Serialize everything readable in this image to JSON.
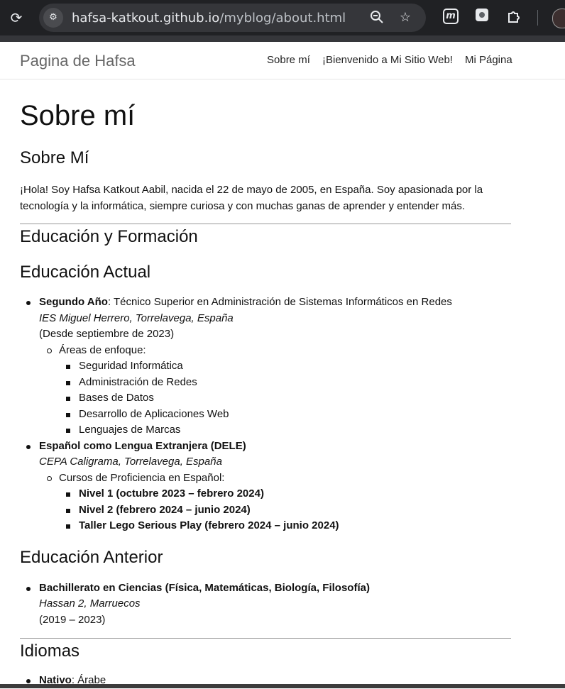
{
  "browser": {
    "url_host": "hafsa-katkout.github.io",
    "url_path": "/myblog/about.html"
  },
  "nav": {
    "brand": "Pagina de Hafsa",
    "links": [
      "Sobre mí",
      "¡Bienvenido a Mi Sitio Web!",
      "Mi Página"
    ]
  },
  "page": {
    "title": "Sobre mí",
    "about_heading": "Sobre Mí",
    "intro": "¡Hola! Soy Hafsa Katkout Aabil, nacida el 22 de mayo de 2005, en España. Soy apasionada por la tecnología y la informática, siempre curiosa y con muchas ganas de aprender y entender más.",
    "education_heading": "Educación y Formación",
    "current_heading": "Educación Actual",
    "current": {
      "item1_strong": "Segundo Año",
      "item1_rest": ": Técnico Superior en Administración de Sistemas Informáticos en Redes",
      "item1_place": "IES Miguel Herrero, Torrelavega, España",
      "item1_date": "(Desde septiembre de 2023)",
      "focus_label": "Áreas de enfoque:",
      "focus_items": [
        "Seguridad Informática",
        "Administración de Redes",
        "Bases de Datos",
        "Desarrollo de Aplicaciones Web",
        "Lenguajes de Marcas"
      ],
      "item2_strong": "Español como Lengua Extranjera (DELE)",
      "item2_place": "CEPA Caligrama, Torrelavega, España",
      "courses_label": "Cursos de Proficiencia en Español:",
      "course_items": [
        "Nivel 1 (octubre 2023 – febrero 2024)",
        "Nivel 2 (febrero 2024 – junio 2024)",
        "Taller Lego Serious Play (febrero 2024 – junio 2024)"
      ]
    },
    "previous_heading": "Educación Anterior",
    "previous": {
      "item_strong": "Bachillerato en Ciencias (Física, Matemáticas, Biología, Filosofía)",
      "item_place": "Hassan 2, Marruecos",
      "item_date": "(2019 – 2023)"
    },
    "languages_heading": "Idiomas",
    "languages": {
      "item_strong": "Nativo",
      "item_rest": ": Árabe"
    }
  }
}
